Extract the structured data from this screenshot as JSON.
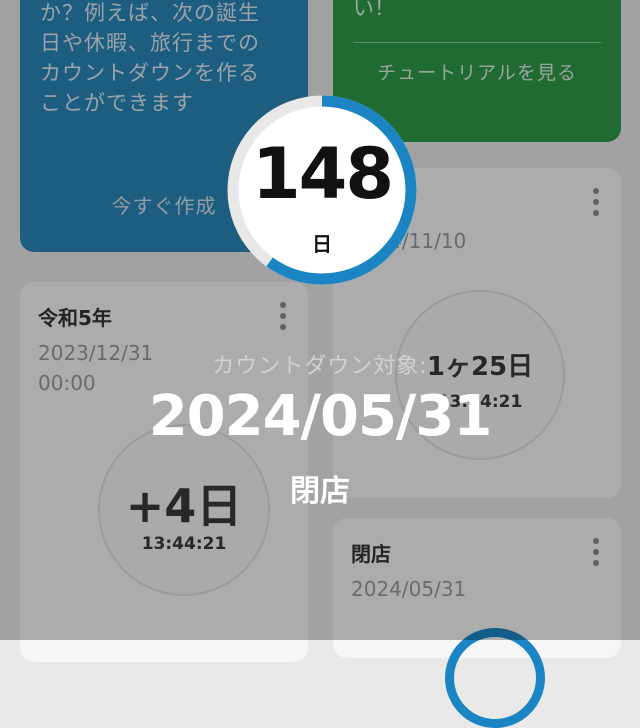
{
  "cards": {
    "blue": {
      "text": "か？例えば、次の誕生日や休暇、旅行までのカウントダウンを作ることができます",
      "action": "今すぐ作成"
    },
    "green": {
      "text": "い！",
      "action": "チュートリアルを見る"
    },
    "card_a": {
      "title": "令和5年",
      "date": "2023/12/31",
      "time": "00:00",
      "ring_value": "+4日",
      "ring_time": "13:44:21"
    },
    "card_b": {
      "date": "2024/11/10",
      "ring_value": "1ヶ25日",
      "ring_time": "13:44:21"
    },
    "card_c": {
      "title": "閉店",
      "date": "2024/05/31"
    }
  },
  "popup": {
    "days_value": "148",
    "days_unit": "日",
    "progress_fraction": 0.6,
    "target_label": "カウントダウン対象:",
    "target_date": "2024/05/31",
    "target_name": "閉店"
  },
  "colors": {
    "progress_arc": "#1b85c4",
    "blue_card": "#2a86b8",
    "green_card": "#2e9a48"
  }
}
